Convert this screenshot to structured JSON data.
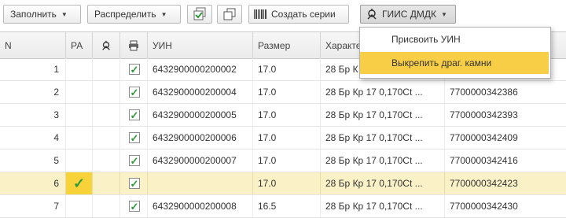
{
  "toolbar": {
    "fill_label": "Заполнить",
    "distribute_label": "Распределить",
    "create_series_label": "Создать серии",
    "giis_label": "ГИИС ДМДК"
  },
  "menu": {
    "items": [
      {
        "label": "Присвоить УИН"
      },
      {
        "label": "Выкрепить драг. камни"
      }
    ]
  },
  "table": {
    "headers": {
      "n": "N",
      "pa": "РА",
      "uin": "УИН",
      "size": "Размер",
      "char": "Характе"
    },
    "rows": [
      {
        "n": "1",
        "pa": "",
        "printed": true,
        "uin": "6432900000200002",
        "size": "17.0",
        "char": "28 Бр К",
        "series": ""
      },
      {
        "n": "2",
        "pa": "",
        "printed": true,
        "uin": "6432900000200004",
        "size": "17.0",
        "char": "28 Бр Кр 17 0,170Ct ...",
        "series": "7700000342386"
      },
      {
        "n": "3",
        "pa": "",
        "printed": true,
        "uin": "6432900000200005",
        "size": "17.0",
        "char": "28 Бр Кр 17 0,170Ct ...",
        "series": "7700000342393"
      },
      {
        "n": "4",
        "pa": "",
        "printed": true,
        "uin": "6432900000200006",
        "size": "17.0",
        "char": "28 Бр Кр 17 0,170Ct ...",
        "series": "7700000342409"
      },
      {
        "n": "5",
        "pa": "",
        "printed": true,
        "uin": "6432900000200007",
        "size": "17.0",
        "char": "28 Бр Кр 17 0,170Ct ...",
        "series": "7700000342416"
      },
      {
        "n": "6",
        "pa": "✓",
        "printed": true,
        "uin": "",
        "size": "17.0",
        "char": "28 Бр Кр 17 0,170Ct ...",
        "series": "7700000342423"
      },
      {
        "n": "7",
        "pa": "",
        "printed": true,
        "uin": "6432900000200008",
        "size": "16.5",
        "char": "28 Бр Кр 17 0,170Ct ...",
        "series": "7700000342430"
      }
    ]
  },
  "colors": {
    "selected_row": "#fbf1c7",
    "menu_highlight": "#f7ce46",
    "check_green": "#2e9a38"
  }
}
